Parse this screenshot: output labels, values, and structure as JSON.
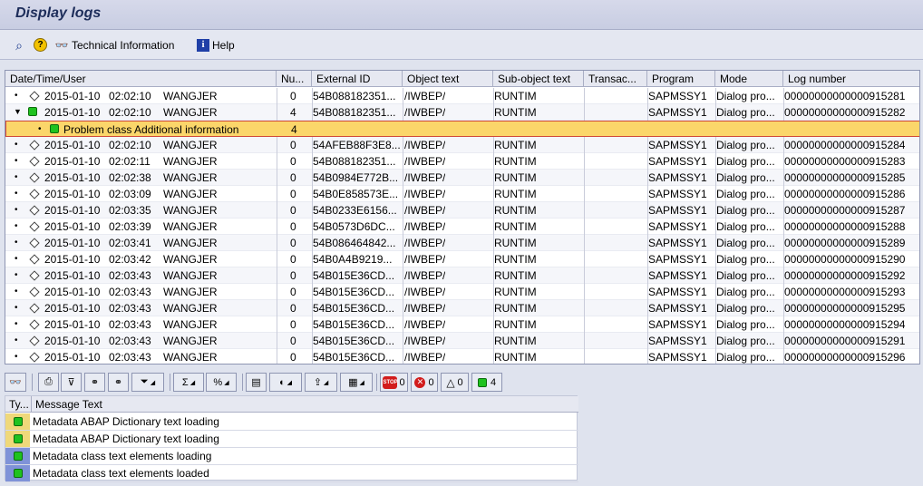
{
  "title": "Display logs",
  "toolbar": {
    "technical_information": "Technical Information",
    "help": "Help"
  },
  "columns": [
    "Date/Time/User",
    "Nu...",
    "External ID",
    "Object text",
    "Sub-object text",
    "Transac...",
    "Program",
    "Mode",
    "Log number"
  ],
  "rows": [
    {
      "date": "2015-01-10",
      "time": "02:02:10",
      "user": "WANGJER",
      "num": "0",
      "ext": "54B088182351...",
      "obj": "/IWBEP/",
      "sub": "RUNTIM",
      "tr": "",
      "prog": "SAPMSSY1",
      "mode": "Dialog pro...",
      "log": "00000000000000915281",
      "icon": "diamond"
    },
    {
      "date": "2015-01-10",
      "time": "02:02:10",
      "user": "WANGJER",
      "num": "4",
      "ext": "54B088182351...",
      "obj": "/IWBEP/",
      "sub": "RUNTIM",
      "tr": "",
      "prog": "SAPMSSY1",
      "mode": "Dialog pro...",
      "log": "00000000000000915282",
      "icon": "green",
      "expanded": true
    },
    {
      "child": true,
      "label": "Problem class Additional information",
      "num": "4"
    },
    {
      "date": "2015-01-10",
      "time": "02:02:10",
      "user": "WANGJER",
      "num": "0",
      "ext": "54AFEB88F3E8...",
      "obj": "/IWBEP/",
      "sub": "RUNTIM",
      "tr": "",
      "prog": "SAPMSSY1",
      "mode": "Dialog pro...",
      "log": "00000000000000915284",
      "icon": "diamond"
    },
    {
      "date": "2015-01-10",
      "time": "02:02:11",
      "user": "WANGJER",
      "num": "0",
      "ext": "54B088182351...",
      "obj": "/IWBEP/",
      "sub": "RUNTIM",
      "tr": "",
      "prog": "SAPMSSY1",
      "mode": "Dialog pro...",
      "log": "00000000000000915283",
      "icon": "diamond"
    },
    {
      "date": "2015-01-10",
      "time": "02:02:38",
      "user": "WANGJER",
      "num": "0",
      "ext": "54B0984E772B...",
      "obj": "/IWBEP/",
      "sub": "RUNTIM",
      "tr": "",
      "prog": "SAPMSSY1",
      "mode": "Dialog pro...",
      "log": "00000000000000915285",
      "icon": "diamond"
    },
    {
      "date": "2015-01-10",
      "time": "02:03:09",
      "user": "WANGJER",
      "num": "0",
      "ext": "54B0E858573E...",
      "obj": "/IWBEP/",
      "sub": "RUNTIM",
      "tr": "",
      "prog": "SAPMSSY1",
      "mode": "Dialog pro...",
      "log": "00000000000000915286",
      "icon": "diamond"
    },
    {
      "date": "2015-01-10",
      "time": "02:03:35",
      "user": "WANGJER",
      "num": "0",
      "ext": "54B0233E6156...",
      "obj": "/IWBEP/",
      "sub": "RUNTIM",
      "tr": "",
      "prog": "SAPMSSY1",
      "mode": "Dialog pro...",
      "log": "00000000000000915287",
      "icon": "diamond"
    },
    {
      "date": "2015-01-10",
      "time": "02:03:39",
      "user": "WANGJER",
      "num": "0",
      "ext": "54B0573D6DC...",
      "obj": "/IWBEP/",
      "sub": "RUNTIM",
      "tr": "",
      "prog": "SAPMSSY1",
      "mode": "Dialog pro...",
      "log": "00000000000000915288",
      "icon": "diamond"
    },
    {
      "date": "2015-01-10",
      "time": "02:03:41",
      "user": "WANGJER",
      "num": "0",
      "ext": "54B086464842...",
      "obj": "/IWBEP/",
      "sub": "RUNTIM",
      "tr": "",
      "prog": "SAPMSSY1",
      "mode": "Dialog pro...",
      "log": "00000000000000915289",
      "icon": "diamond"
    },
    {
      "date": "2015-01-10",
      "time": "02:03:42",
      "user": "WANGJER",
      "num": "0",
      "ext": "54B0A4B9219...",
      "obj": "/IWBEP/",
      "sub": "RUNTIM",
      "tr": "",
      "prog": "SAPMSSY1",
      "mode": "Dialog pro...",
      "log": "00000000000000915290",
      "icon": "diamond"
    },
    {
      "date": "2015-01-10",
      "time": "02:03:43",
      "user": "WANGJER",
      "num": "0",
      "ext": "54B015E36CD...",
      "obj": "/IWBEP/",
      "sub": "RUNTIM",
      "tr": "",
      "prog": "SAPMSSY1",
      "mode": "Dialog pro...",
      "log": "00000000000000915292",
      "icon": "diamond"
    },
    {
      "date": "2015-01-10",
      "time": "02:03:43",
      "user": "WANGJER",
      "num": "0",
      "ext": "54B015E36CD...",
      "obj": "/IWBEP/",
      "sub": "RUNTIM",
      "tr": "",
      "prog": "SAPMSSY1",
      "mode": "Dialog pro...",
      "log": "00000000000000915293",
      "icon": "diamond"
    },
    {
      "date": "2015-01-10",
      "time": "02:03:43",
      "user": "WANGJER",
      "num": "0",
      "ext": "54B015E36CD...",
      "obj": "/IWBEP/",
      "sub": "RUNTIM",
      "tr": "",
      "prog": "SAPMSSY1",
      "mode": "Dialog pro...",
      "log": "00000000000000915295",
      "icon": "diamond"
    },
    {
      "date": "2015-01-10",
      "time": "02:03:43",
      "user": "WANGJER",
      "num": "0",
      "ext": "54B015E36CD...",
      "obj": "/IWBEP/",
      "sub": "RUNTIM",
      "tr": "",
      "prog": "SAPMSSY1",
      "mode": "Dialog pro...",
      "log": "00000000000000915294",
      "icon": "diamond"
    },
    {
      "date": "2015-01-10",
      "time": "02:03:43",
      "user": "WANGJER",
      "num": "0",
      "ext": "54B015E36CD...",
      "obj": "/IWBEP/",
      "sub": "RUNTIM",
      "tr": "",
      "prog": "SAPMSSY1",
      "mode": "Dialog pro...",
      "log": "00000000000000915291",
      "icon": "diamond"
    },
    {
      "date": "2015-01-10",
      "time": "02:03:43",
      "user": "WANGJER",
      "num": "0",
      "ext": "54B015E36CD...",
      "obj": "/IWBEP/",
      "sub": "RUNTIM",
      "tr": "",
      "prog": "SAPMSSY1",
      "mode": "Dialog pro...",
      "log": "00000000000000915296",
      "icon": "diamond"
    }
  ],
  "lower_toolbar": {
    "stop_label": "STOP",
    "count_stop": "0",
    "count_error": "0",
    "count_warning": "0",
    "count_success": "4"
  },
  "messages": {
    "columns": [
      "Ty...",
      "Message Text"
    ],
    "rows": [
      {
        "text": "Metadata ABAP Dictionary text loading",
        "tint": "yellow"
      },
      {
        "text": "Metadata ABAP Dictionary text loading",
        "tint": "yellow"
      },
      {
        "text": "Metadata class text elements loading",
        "tint": "blue"
      },
      {
        "text": "Metadata class text elements loaded",
        "tint": "blue"
      }
    ]
  },
  "colors": {
    "selected_row": "#fbd66a",
    "success_green": "#1fc21f",
    "title_text": "#1d2d5a"
  }
}
